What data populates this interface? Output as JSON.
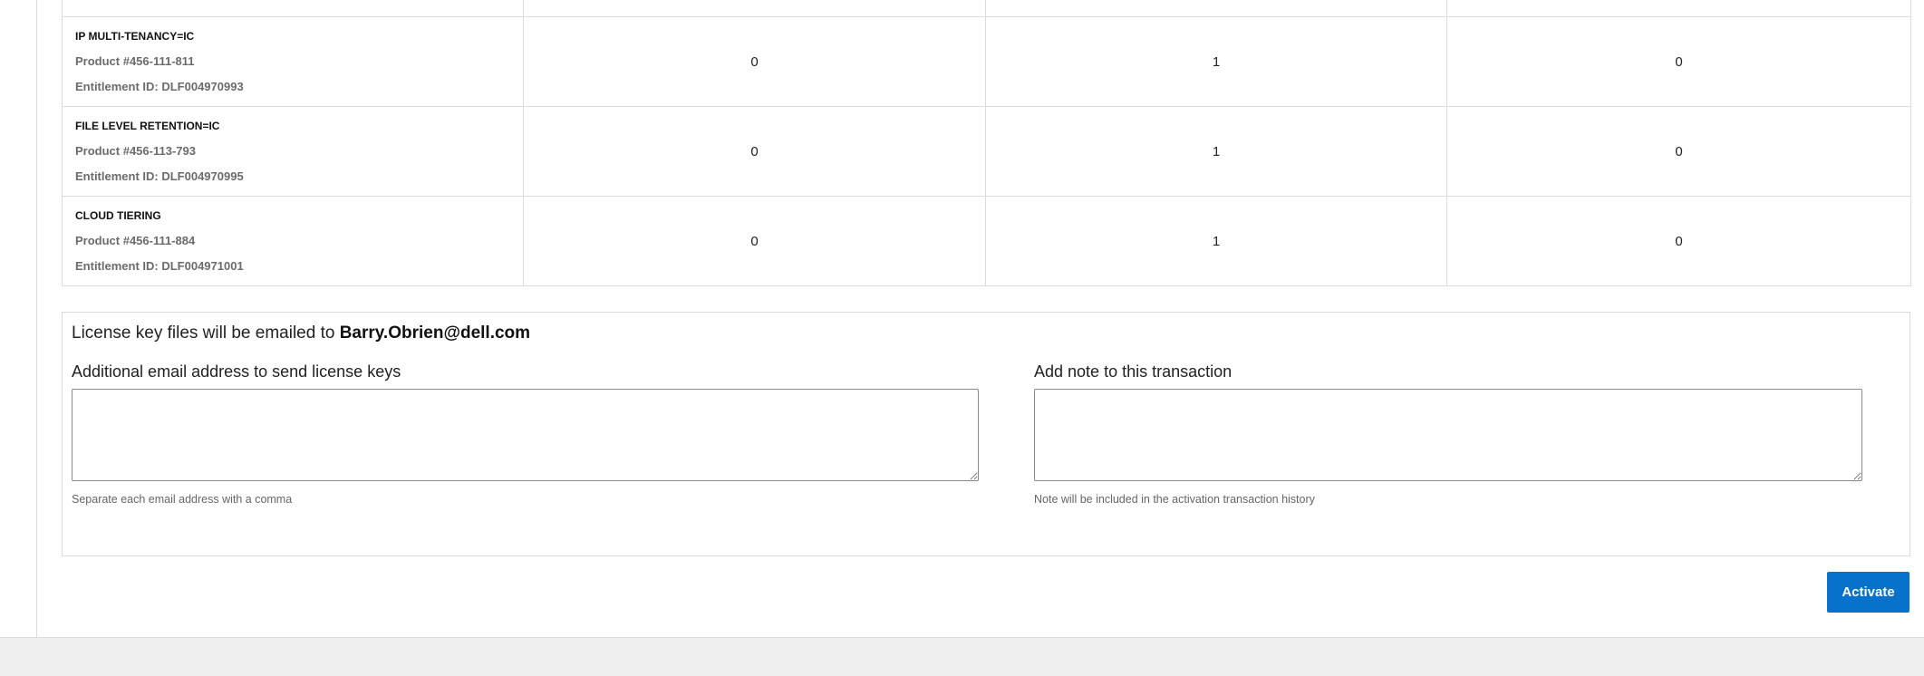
{
  "products": [
    {
      "name": "IP MULTI-TENANCY=IC",
      "product": "Product #456-111-811",
      "entitlement": "Entitlement ID: DLF004970993",
      "values": [
        "0",
        "1",
        "0"
      ]
    },
    {
      "name": "FILE LEVEL RETENTION=IC",
      "product": "Product #456-113-793",
      "entitlement": "Entitlement ID: DLF004970995",
      "values": [
        "0",
        "1",
        "0"
      ]
    },
    {
      "name": "CLOUD TIERING",
      "product": "Product #456-111-884",
      "entitlement": "Entitlement ID: DLF004971001",
      "values": [
        "0",
        "1",
        "0"
      ]
    }
  ],
  "form": {
    "notice_prefix": "License key files will be emailed to ",
    "notice_email": "Barry.Obrien@dell.com",
    "email_label": "Additional email address to send license keys",
    "email_value": "",
    "email_help": "Separate each email address with a comma",
    "note_label": "Add note to this transaction",
    "note_value": "",
    "note_help": "Note will be included in the activation transaction history"
  },
  "actions": {
    "activate_label": "Activate"
  },
  "colors": {
    "primary": "#0672cb",
    "border": "#dcdcdc",
    "footer": "#efefef"
  }
}
